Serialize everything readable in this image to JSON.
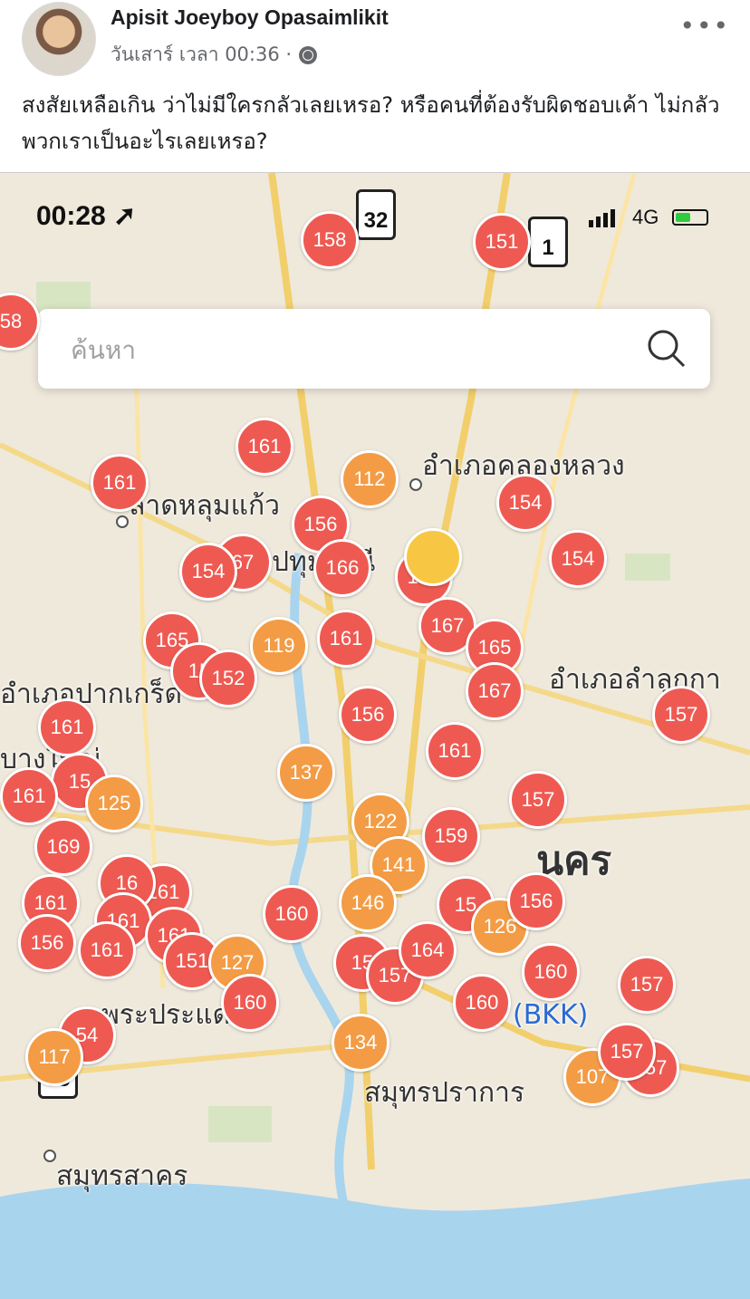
{
  "post": {
    "author": "Apisit Joeyboy Opasaimlikit",
    "meta": "วันเสาร์ เวลา 00:36 ·",
    "more": "•••",
    "text": "สงสัยเหลือเกิน ว่าไม่มีใครกลัวเลยเหรอ? หรือคนที่ต้องรับผิดชอบเค้า ไม่กลัวพวกเราเป็นอะไรเลยเหรอ?"
  },
  "screenshot": {
    "status": {
      "time": "00:28",
      "network": "4G"
    },
    "search": {
      "placeholder": "ค้นหา"
    },
    "places": {
      "khlong_luang": "อำเภอคลองหลวง",
      "lat_lum_kaeo": "ลาดหลุมแก้ว",
      "pathum": "ปทุมธานี",
      "pak_kret": "อำเภอปากเกร็ด",
      "bang_yai": "บางใหญ่",
      "lam_luk_ka": "อำเภอลำลูกกา",
      "bangkok": "นคร",
      "bkk": "(BKK)",
      "samut_prakan": "สมุทรปราการ",
      "samut_sakhon": "สมุทรสาคร",
      "phra_pradaeng": "พระประแดง"
    },
    "highways": [
      "32",
      "1",
      "35"
    ],
    "markers": [
      "158",
      "151",
      "58",
      "161",
      "161",
      "112",
      "154",
      "156",
      "154",
      "67",
      "166",
      "154",
      "154",
      "165",
      "119",
      "161",
      "167",
      "165",
      "15",
      "152",
      "167",
      "157",
      "161",
      "156",
      "161",
      "15",
      "125",
      "161",
      "137",
      "122",
      "157",
      "169",
      "161",
      "161",
      "16",
      "159",
      "141",
      "161",
      "161",
      "156",
      "160",
      "146",
      "15",
      "126",
      "156",
      "161",
      "151",
      "127",
      "15",
      "157",
      "164",
      "160",
      "157",
      "160",
      "160",
      "134",
      "54",
      "117",
      "107",
      "157",
      "157"
    ],
    "colors": {
      "red": "#ee5a52",
      "orange": "#f39c45",
      "yellow": "#f7c744",
      "water": "#a9d4ee"
    }
  }
}
